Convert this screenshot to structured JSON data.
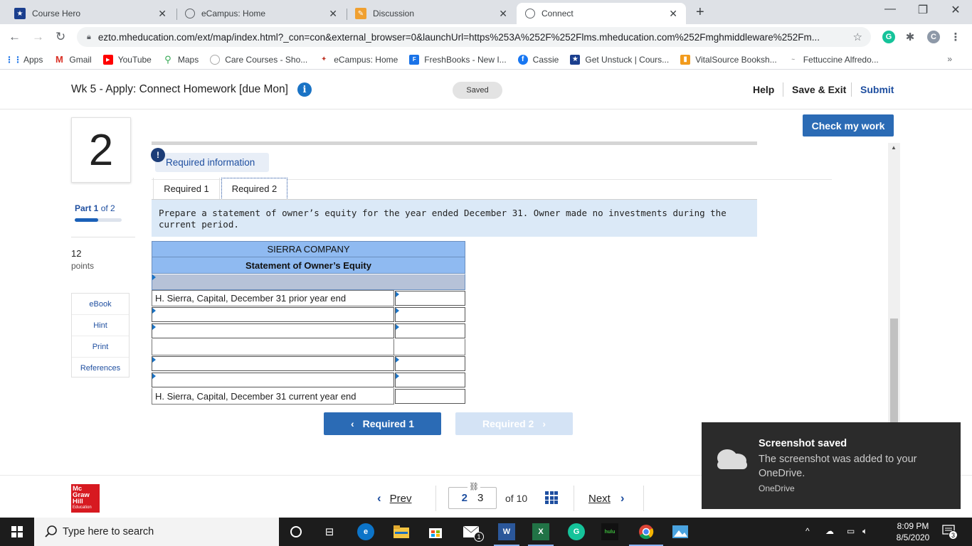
{
  "browser": {
    "tabs": [
      {
        "title": "Course Hero",
        "icon": "course-hero-icon"
      },
      {
        "title": "eCampus: Home",
        "icon": "ecampus-icon"
      },
      {
        "title": "Discussion",
        "icon": "discussion-icon"
      },
      {
        "title": "Connect",
        "icon": "connect-icon"
      }
    ],
    "url": "ezto.mheducation.com/ext/map/index.html?_con=con&external_browser=0&launchUrl=https%253A%252F%252Flms.mheducation.com%252Fmghmiddleware%252Fm...",
    "profile_letter": "C",
    "bookmarks": [
      "Apps",
      "Gmail",
      "YouTube",
      "Maps",
      "Care Courses - Sho...",
      "eCampus: Home",
      "FreshBooks - New I...",
      "Cassie",
      "Get Unstuck | Cours...",
      "VitalSource Booksh...",
      "Fettuccine Alfredo..."
    ],
    "bookmarks_more": "»"
  },
  "header": {
    "title": "Wk 5 - Apply: Connect Homework [due Mon]",
    "saved": "Saved",
    "help": "Help",
    "save_exit": "Save & Exit",
    "submit": "Submit"
  },
  "rail": {
    "question_number": "2",
    "part_label": "Part 1",
    "part_of": " of 2",
    "part_progress": 0.5,
    "points_value": "12",
    "points_label": "points",
    "tools": [
      "eBook",
      "Hint",
      "Print",
      "References"
    ]
  },
  "question": {
    "check_my_work": "Check my work",
    "required_info": "Required information",
    "tabs": [
      "Required 1",
      "Required 2"
    ],
    "instructions": "Prepare a statement of owner’s equity for the year ended December 31. Owner made no investments during the current period.",
    "worksheet": {
      "company": "SIERRA COMPANY",
      "statement": "Statement of Owner’s Equity",
      "first_row": "H. Sierra, Capital, December 31 prior year end",
      "last_row": "H. Sierra, Capital, December 31 current year end"
    },
    "btn_prev": "Required 1",
    "btn_next": "Required 2"
  },
  "footer": {
    "logo": [
      "Mc",
      "Graw",
      "Hill",
      "Education"
    ],
    "prev": "Prev",
    "current_page": "2",
    "page_input": "3",
    "of_total": "of 10",
    "next": "Next"
  },
  "toast": {
    "title": "Screenshot saved",
    "body": "The screenshot was added to your OneDrive.",
    "source": "OneDrive"
  },
  "taskbar": {
    "search_placeholder": "Type here to search",
    "time": "8:09 PM",
    "date": "8/5/2020",
    "notification_count": "3",
    "mail_badge": "1"
  }
}
